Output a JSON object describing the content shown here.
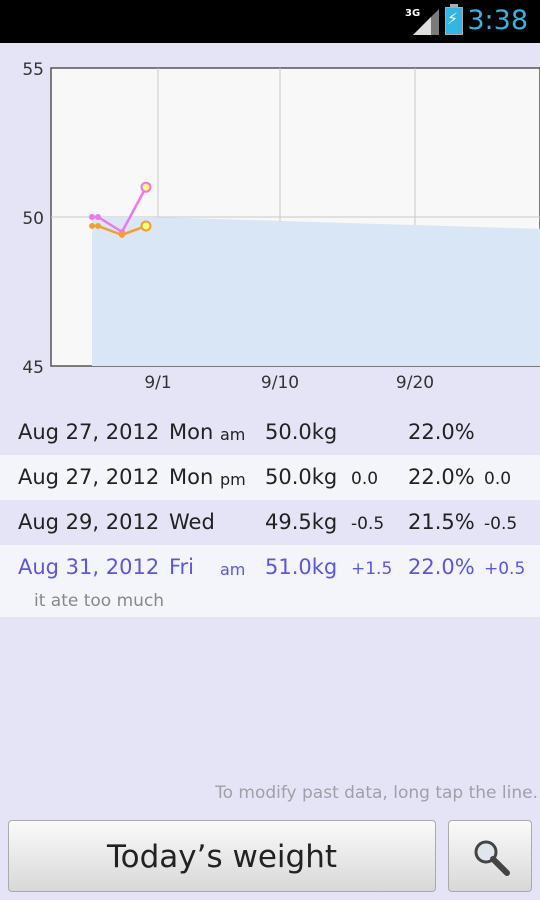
{
  "status_bar": {
    "network": "3G",
    "time": "3:38",
    "accent_color": "#33b5e5"
  },
  "chart_data": {
    "type": "line",
    "y_ticks": [
      "55",
      "50",
      "45"
    ],
    "ylim": [
      45,
      55
    ],
    "x_ticks": [
      "9/1",
      "9/10",
      "9/20"
    ],
    "grid": true,
    "series": [
      {
        "x": [
          "Aug 27 am",
          "Aug 27 pm",
          "Aug 29",
          "Aug 31 am"
        ],
        "values": [
          50.0,
          50.0,
          49.5,
          51.0
        ],
        "color": "#ee77ee"
      },
      {
        "x": [
          "Aug 27 am",
          "Aug 27 pm",
          "Aug 29",
          "Aug 31 am"
        ],
        "values": [
          49.7,
          49.7,
          49.4,
          49.7
        ],
        "color": "#f0a030"
      }
    ],
    "area": {
      "color": "#d8e6f6",
      "start_value": 50.0,
      "end_value": 49.6
    }
  },
  "entries": [
    {
      "date": "Aug 27, 2012",
      "dow": "Mon",
      "ampm": "am",
      "weight": "50.0kg",
      "weight_diff": "",
      "fat": "22.0%",
      "fat_diff": "",
      "note": ""
    },
    {
      "date": "Aug 27, 2012",
      "dow": "Mon",
      "ampm": "pm",
      "weight": "50.0kg",
      "weight_diff": "0.0",
      "fat": "22.0%",
      "fat_diff": "0.0",
      "note": ""
    },
    {
      "date": "Aug 29, 2012",
      "dow": "Wed",
      "ampm": "",
      "weight": "49.5kg",
      "weight_diff": "-0.5",
      "fat": "21.5%",
      "fat_diff": "-0.5",
      "note": ""
    },
    {
      "date": "Aug 31, 2012",
      "dow": "Fri",
      "ampm": "am",
      "weight": "51.0kg",
      "weight_diff": "+1.5",
      "fat": "22.0%",
      "fat_diff": "+0.5",
      "note": "it ate too much"
    }
  ],
  "hint": "To modify past data, long tap the line.",
  "buttons": {
    "todays_weight": "Today’s weight",
    "search_icon": "search-icon"
  }
}
